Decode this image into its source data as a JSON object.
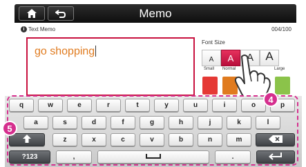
{
  "header": {
    "title": "Memo",
    "home_icon": "home-icon",
    "back_icon": "back-arrow-icon"
  },
  "info": {
    "label": "Text Memo",
    "counter": "004/100"
  },
  "memo": {
    "value": "go shopping"
  },
  "font_size": {
    "label": "Font Size",
    "options": [
      {
        "glyph": "A",
        "name": "Small"
      },
      {
        "glyph": "A",
        "name": "Normal"
      },
      {
        "glyph": "A",
        "name": ""
      },
      {
        "glyph": "A",
        "name": "Large"
      }
    ],
    "selected_index": 1
  },
  "colors": {
    "accent": "#c8103e",
    "swatches": [
      "#e53935",
      "#e07b1f",
      "#8bc34a"
    ]
  },
  "callouts": {
    "four": "4",
    "five": "5"
  },
  "keyboard": {
    "row1": [
      "q",
      "w",
      "e",
      "r",
      "t",
      "y",
      "u",
      "i",
      "o",
      "p"
    ],
    "row2": [
      "a",
      "s",
      "d",
      "f",
      "g",
      "h",
      "j",
      "k",
      "l"
    ],
    "row3": [
      "z",
      "x",
      "c",
      "v",
      "b",
      "n",
      "m"
    ],
    "shift_icon": "shift-arrow-icon",
    "backspace_icon": "backspace-icon",
    "numbers_label": "?123",
    "comma_label": ",",
    "space_icon": "space-bar-icon",
    "period_label": ".",
    "enter_icon": "enter-icon"
  }
}
